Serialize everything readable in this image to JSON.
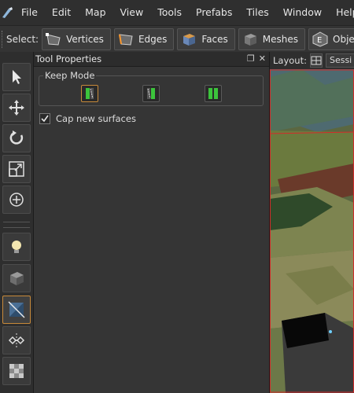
{
  "menubar": {
    "items": [
      "File",
      "Edit",
      "Map",
      "View",
      "Tools",
      "Prefabs",
      "Tiles",
      "Window",
      "Help"
    ]
  },
  "selectbar": {
    "label": "Select:",
    "buttons": [
      "Vertices",
      "Edges",
      "Faces",
      "Meshes",
      "Objects"
    ]
  },
  "tool_properties": {
    "title": "Tool Properties",
    "keep_mode_label": "Keep Mode",
    "cap_label": "Cap new surfaces",
    "cap_checked": true
  },
  "viewport": {
    "layout_label": "Layout:",
    "session_label": "Sessi"
  },
  "colors": {
    "accent": "#c88a3a",
    "green": "#3cc43c",
    "red_border": "#d32a2a"
  },
  "icons": {
    "tools": [
      "pointer-icon",
      "move-icon",
      "rotate-icon",
      "scale-icon",
      "pivot-icon",
      "light-icon",
      "block-icon",
      "clip-icon",
      "vertex-edit-icon",
      "texture-icon"
    ]
  }
}
